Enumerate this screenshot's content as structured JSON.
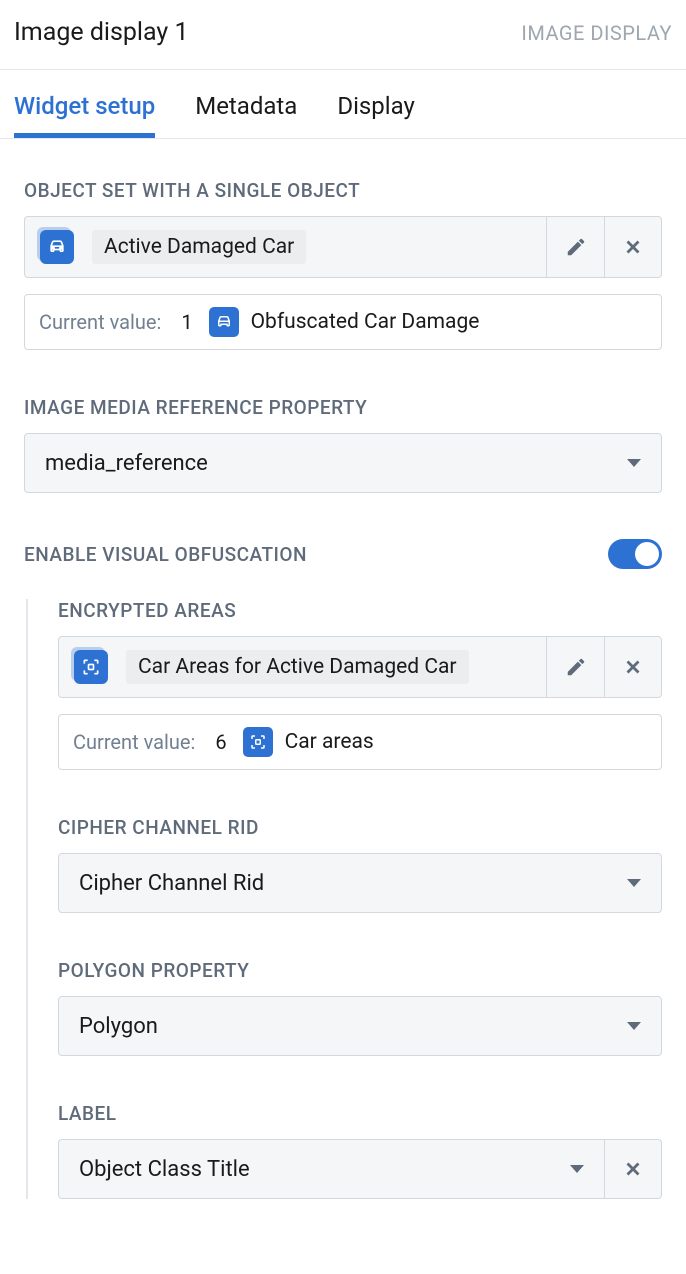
{
  "header": {
    "title": "Image display 1",
    "type": "IMAGE DISPLAY"
  },
  "tabs": {
    "widget_setup": "Widget setup",
    "metadata": "Metadata",
    "display": "Display"
  },
  "object_set": {
    "label": "OBJECT SET WITH A SINGLE OBJECT",
    "chip": "Active Damaged Car",
    "current_label": "Current value:",
    "current_count": "1",
    "current_text": "Obfuscated Car Damage"
  },
  "media_ref": {
    "label": "IMAGE MEDIA REFERENCE PROPERTY",
    "value": "media_reference"
  },
  "obfuscation": {
    "label": "ENABLE VISUAL OBFUSCATION"
  },
  "encrypted": {
    "label": "ENCRYPTED AREAS",
    "chip": "Car Areas for Active Damaged Car",
    "current_label": "Current value:",
    "current_count": "6",
    "current_text": "Car areas"
  },
  "cipher": {
    "label": "CIPHER CHANNEL RID",
    "value": "Cipher Channel Rid"
  },
  "polygon": {
    "label": "POLYGON PROPERTY",
    "value": "Polygon"
  },
  "label_field": {
    "label": "LABEL",
    "value": "Object Class Title"
  }
}
